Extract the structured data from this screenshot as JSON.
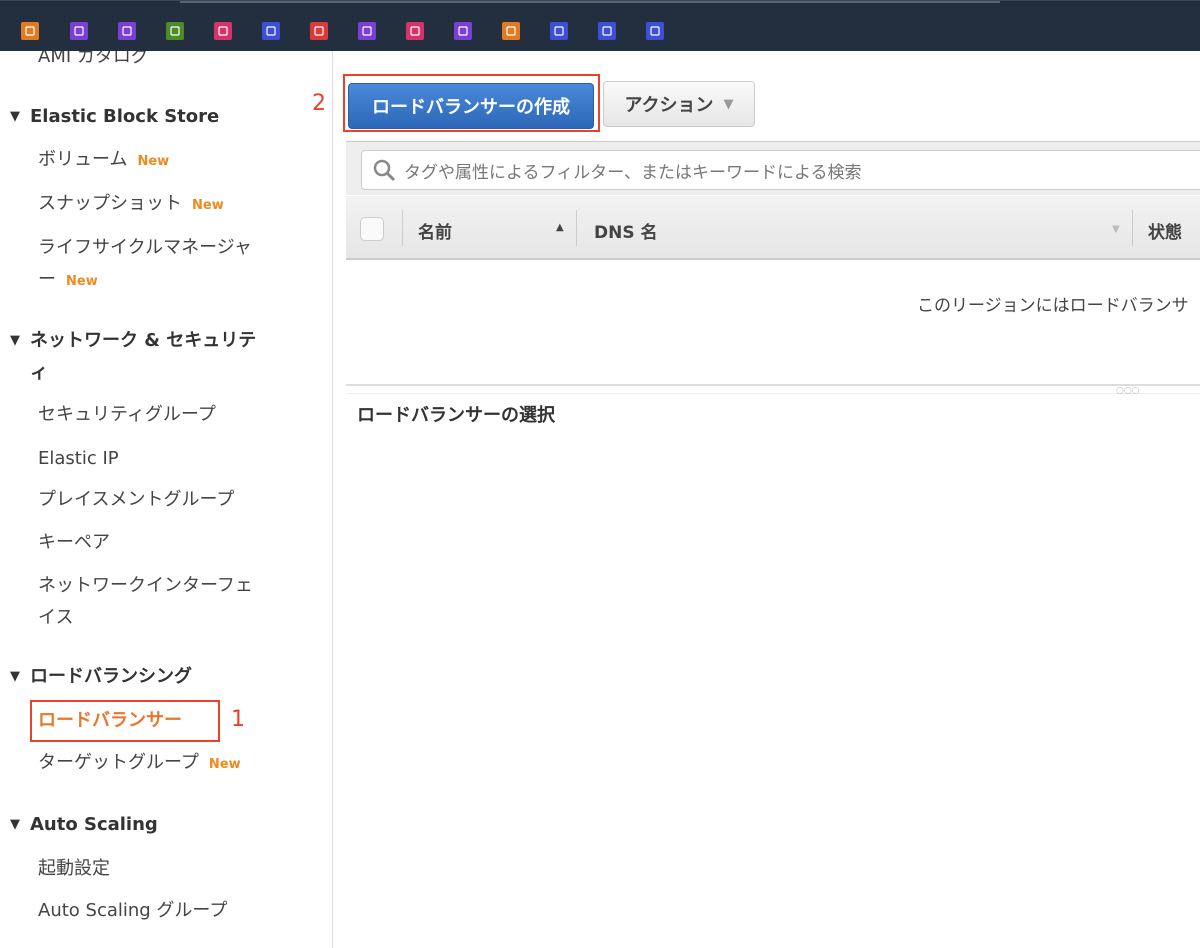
{
  "service_icons": [
    {
      "name": "ec2-icon",
      "color": "#e07b24"
    },
    {
      "name": "s3-glacier-icon",
      "color": "#7b3fd6"
    },
    {
      "name": "cloud-upload-icon",
      "color": "#7b3fd6"
    },
    {
      "name": "s3-bucket-icon",
      "color": "#4d8a2a"
    },
    {
      "name": "mobile-cloud-icon",
      "color": "#d6336c"
    },
    {
      "name": "rekognition-icon",
      "color": "#3b4fd8"
    },
    {
      "name": "id-card-icon",
      "color": "#d93a3a"
    },
    {
      "name": "shield-icon",
      "color": "#7b3fd6"
    },
    {
      "name": "cloud-settings-icon",
      "color": "#d6336c"
    },
    {
      "name": "globe-icon",
      "color": "#7b3fd6"
    },
    {
      "name": "lambda-icon",
      "color": "#e07b24"
    },
    {
      "name": "step-functions-icon",
      "color": "#3b4fd8"
    },
    {
      "name": "code-store-icon",
      "color": "#3b4fd8"
    },
    {
      "name": "building-icon",
      "color": "#3b4fd8"
    }
  ],
  "sidebar": {
    "cut_item": "AMI カタログ",
    "new_badge": "New",
    "sections": [
      {
        "title": "Elastic Block Store",
        "items": [
          "ボリューム",
          "スナップショット",
          "ライフサイクルマネージャー"
        ]
      },
      {
        "title": "ネットワーク & セキュリティ",
        "items": [
          "セキュリティグループ",
          "Elastic IP",
          "プレイスメントグループ",
          "キーペア",
          "ネットワークインターフェイス"
        ]
      },
      {
        "title": "ロードバランシング",
        "items": [
          "ロードバランサー",
          "ターゲットグループ"
        ],
        "active": "ロードバランサー"
      },
      {
        "title": "Auto Scaling",
        "items": [
          "起動設定",
          "Auto Scaling グループ"
        ]
      }
    ],
    "nic_line1": "ネットワークインターフェ",
    "nic_line2": "イス",
    "lcm_line1": "ライフサイクルマネージャ",
    "lcm_line2": "ー",
    "net_line1": "ネットワーク & セキュリテ",
    "net_line2": "ィ"
  },
  "annotations": {
    "step1": "1",
    "step2": "2",
    "accent": "#e8412c"
  },
  "toolbar": {
    "create_label": "ロードバランサーの作成",
    "actions_label": "アクション"
  },
  "search": {
    "placeholder": "タグや属性によるフィルター、またはキーワードによる検索"
  },
  "table": {
    "columns": [
      "名前",
      "DNS 名",
      "状態"
    ],
    "empty_message": "このリージョンにはロードバランサ"
  },
  "detail": {
    "title": "ロードバランサーの選択"
  }
}
